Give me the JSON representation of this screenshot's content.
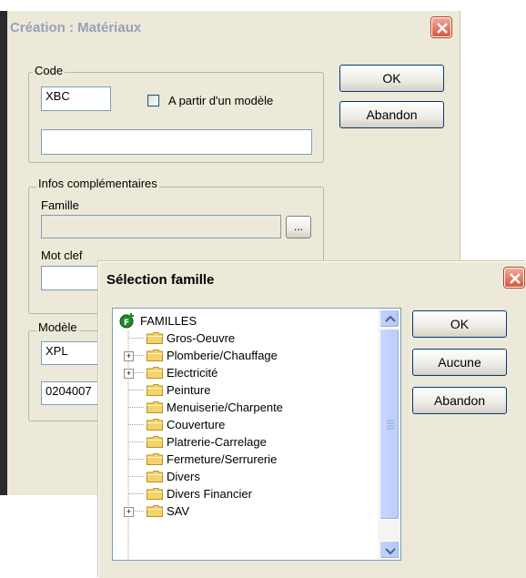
{
  "creation": {
    "title": "Création : Matériaux",
    "code_group": "Code",
    "code_value": "XBC",
    "modele_checkbox_label": "A partir d'un modèle",
    "code_extra_value": "",
    "ok_label": "OK",
    "abandon_label": "Abandon",
    "infos_group": "Infos complémentaires",
    "famille_label": "Famille",
    "famille_value": "",
    "browse_label": "...",
    "mot_clef_label": "Mot clef",
    "mot_clef_value": "",
    "modele_group": "Modèle",
    "modele_value1": "XPL",
    "modele_value2": "0204007"
  },
  "selection": {
    "title": "Sélection famille",
    "ok_label": "OK",
    "aucune_label": "Aucune",
    "abandon_label": "Abandon",
    "tree": {
      "root": "FAMILLES",
      "items": [
        {
          "label": "Gros-Oeuvre",
          "expandable": false
        },
        {
          "label": "Plomberie/Chauffage",
          "expandable": true
        },
        {
          "label": "Electricité",
          "expandable": true
        },
        {
          "label": "Peinture",
          "expandable": false
        },
        {
          "label": "Menuiserie/Charpente",
          "expandable": false
        },
        {
          "label": "Couverture",
          "expandable": false
        },
        {
          "label": "Platrerie-Carrelage",
          "expandable": false
        },
        {
          "label": "Fermeture/Serrurerie",
          "expandable": false
        },
        {
          "label": "Divers",
          "expandable": false
        },
        {
          "label": "Divers Financier",
          "expandable": false
        },
        {
          "label": "SAV",
          "expandable": true
        }
      ]
    }
  },
  "colors": {
    "folder": "#f4d36b",
    "title_back": "#9a9fb7",
    "close": "#d8583c"
  },
  "icons": {
    "close": "close-icon",
    "root": "famille-root-icon",
    "folder": "folder-icon"
  }
}
